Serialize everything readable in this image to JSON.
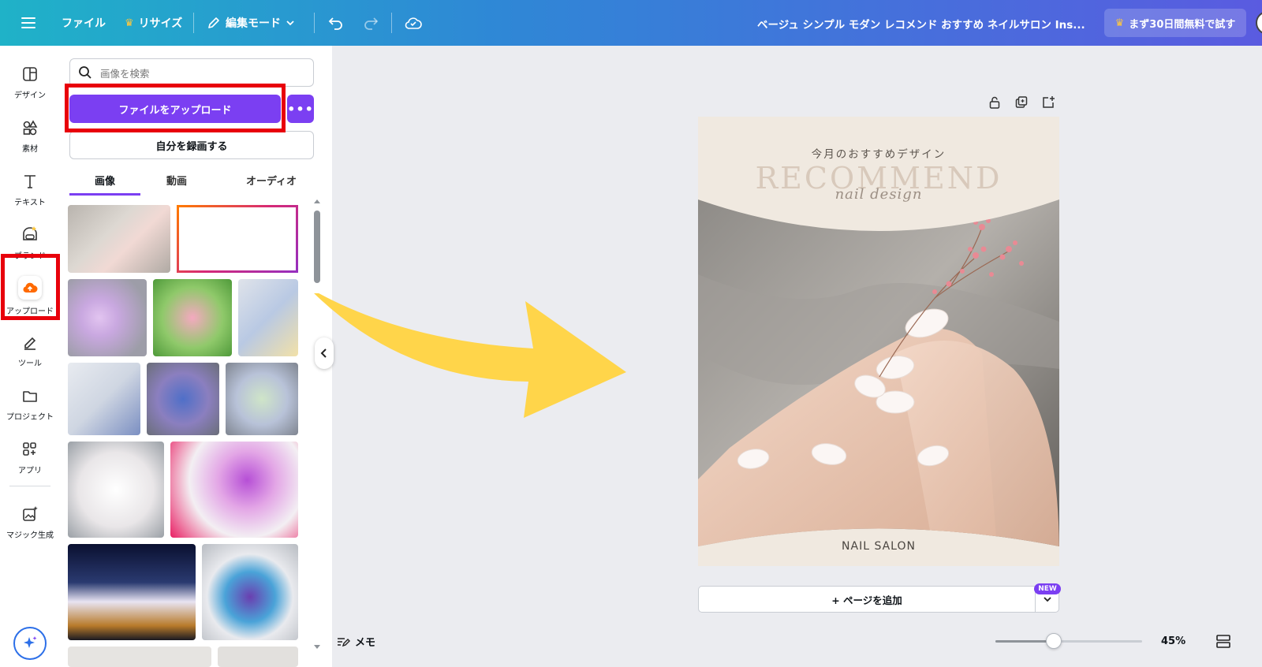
{
  "topbar": {
    "file": "ファイル",
    "resize": "リサイズ",
    "edit_mode": "編集モード",
    "document_title": "ベージュ シンプル モダン レコメンド おすすめ ネイルサロン Ins...",
    "trial_button": "まず30日間無料で試す"
  },
  "rail": {
    "items": [
      {
        "label": "デザイン",
        "icon": "design-icon"
      },
      {
        "label": "素材",
        "icon": "elements-icon"
      },
      {
        "label": "テキスト",
        "icon": "text-icon"
      },
      {
        "label": "ブランド",
        "icon": "brand-icon"
      },
      {
        "label": "アップロード",
        "icon": "upload-cloud-icon"
      },
      {
        "label": "ツール",
        "icon": "tools-icon"
      },
      {
        "label": "プロジェクト",
        "icon": "folder-icon"
      },
      {
        "label": "アプリ",
        "icon": "apps-icon"
      },
      {
        "label": "マジック生成",
        "icon": "magic-media-icon"
      }
    ]
  },
  "panel": {
    "search_placeholder": "画像を検索",
    "upload_button": "ファイルをアップロード",
    "more_button": "•••",
    "record_button": "自分を録画する",
    "tabs": [
      {
        "label": "画像",
        "active": true
      },
      {
        "label": "動画",
        "active": false
      },
      {
        "label": "オーディオ",
        "active": false
      }
    ]
  },
  "design": {
    "subtitle": "今月のおすすめデザイン",
    "title": "RECOMMEND",
    "script": "nail design",
    "footer": "NAIL SALON"
  },
  "canvas": {
    "add_page": "+ ページを追加",
    "new_badge": "NEW",
    "memo": "メモ",
    "zoom": "45%",
    "zoom_fraction": 0.4
  },
  "colors": {
    "accent": "#7b3ff2",
    "highlight": "#e8000b",
    "arrow": "#ffd54a",
    "upload_icon": "#ff6a00"
  }
}
